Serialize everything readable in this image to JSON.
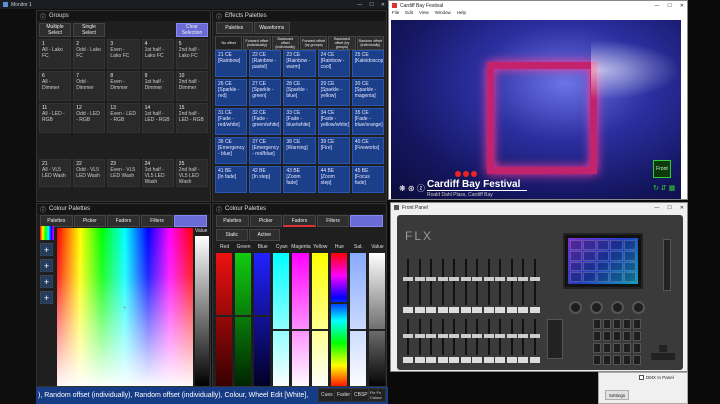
{
  "monitor": {
    "title": "Monitor 1"
  },
  "groups": {
    "title": "Groups",
    "buttons": [
      "Multiple Select",
      "Single Select",
      "Clear Selection"
    ],
    "tiles": [
      {
        "num": "1",
        "label": "All - Lako FC"
      },
      {
        "num": "2",
        "label": "Odd - Lako FC"
      },
      {
        "num": "3",
        "label": "Even - Lako FC"
      },
      {
        "num": "4",
        "label": "1st half - Lako FC"
      },
      {
        "num": "5",
        "label": "2nd half - Lako FC"
      },
      {
        "num": "6",
        "label": "All - Dimmer"
      },
      {
        "num": "7",
        "label": "Odd - Dimmer"
      },
      {
        "num": "8",
        "label": "Even - Dimmer"
      },
      {
        "num": "9",
        "label": "1st half - Dimmer"
      },
      {
        "num": "10",
        "label": "2nd half - Dimmer"
      },
      {
        "num": "11",
        "label": "All - LED - RGB"
      },
      {
        "num": "12",
        "label": "Odd - LED - RGB"
      },
      {
        "num": "13",
        "label": "Even - LED - RGB"
      },
      {
        "num": "14",
        "label": "1st half - LED - RGB"
      },
      {
        "num": "15",
        "label": "2nd half - LED - RGB"
      },
      {
        "num": "21",
        "label": "All - VL5 LED Wash"
      },
      {
        "num": "22",
        "label": "Odd - VL5 LED Wash"
      },
      {
        "num": "23",
        "label": "Even - VL5 LED Wash"
      },
      {
        "num": "24",
        "label": "1st half - VL5 LED Wash"
      },
      {
        "num": "25",
        "label": "2nd half - VL5 LED Wash"
      }
    ]
  },
  "effects": {
    "title": "Effects Palettes",
    "tabs": [
      "Palettes",
      "Waveforms"
    ],
    "headers": [
      "No offset",
      "Forward offset (individually)",
      "Backward offset (individually)",
      "Forward offset (by groups)",
      "Backward offset (by groups)",
      "Random offset (individually)"
    ],
    "tiles": [
      {
        "num": "21 CE",
        "label": "[Rainbow]"
      },
      {
        "num": "22 CE",
        "label": "[Rainbow - pastel]"
      },
      {
        "num": "23 CE",
        "label": "[Rainbow - warm]"
      },
      {
        "num": "24 CE",
        "label": "[Rainbow - cool]"
      },
      {
        "num": "25 CE",
        "label": "[Kaleidoscope]"
      },
      {
        "num": "26 CE",
        "label": "[Sparkle - red]"
      },
      {
        "num": "27 CE",
        "label": "[Sparkle - green]"
      },
      {
        "num": "28 CE",
        "label": "[Sparkle - blue]"
      },
      {
        "num": "29 CE",
        "label": "[Sparkle - yellow]"
      },
      {
        "num": "30 CE",
        "label": "[Sparkle - magenta]"
      },
      {
        "num": "31 CE",
        "label": "[Fade - red/white]"
      },
      {
        "num": "32 CE",
        "label": "[Fade - green/white]"
      },
      {
        "num": "33 CE",
        "label": "[Fade - blue/white]"
      },
      {
        "num": "34 CE",
        "label": "[Fade - yellow/white]"
      },
      {
        "num": "35 CE",
        "label": "[Fade - blue/orange]"
      },
      {
        "num": "36 CE",
        "label": "[Emergency - blue]"
      },
      {
        "num": "37 CE",
        "label": "[Emergency - red/blue]"
      },
      {
        "num": "38 CE",
        "label": "[Warning]"
      },
      {
        "num": "39 CE",
        "label": "[Fire]"
      },
      {
        "num": "40 CE",
        "label": "[Fireworks]"
      },
      {
        "num": "41 BE",
        "label": "[In fade]"
      },
      {
        "num": "42 BE",
        "label": "[In step]"
      },
      {
        "num": "43 BE",
        "label": "[Zoom fade]"
      },
      {
        "num": "44 BE",
        "label": "[Zoom step]"
      },
      {
        "num": "45 BE",
        "label": "[Focus fade]"
      }
    ]
  },
  "colour_left": {
    "title": "Colour Palettes",
    "tabs": [
      "Palettes",
      "Picker",
      "Faders",
      "Filters"
    ],
    "value_label": "Value",
    "plus": [
      "+",
      "+",
      "+",
      "+"
    ]
  },
  "colour_right": {
    "title": "Colour Palettes",
    "tabs": [
      "Palettes",
      "Picker",
      "Faders",
      "Filters"
    ],
    "subtabs": [
      "Static",
      "Active"
    ],
    "fader_labels": [
      "Red",
      "Green",
      "Blue",
      "Cyan",
      "Magenta",
      "Yellow",
      "Hue",
      "Sat.",
      "Value"
    ]
  },
  "status": {
    "text": "), Random offset (individually), Random offset (individually), Colour, Wheel Edit [White],"
  },
  "bottom_tabs": [
    "Cues",
    "Fader",
    "CBSP",
    "Fix Fx Colour"
  ],
  "festival": {
    "window_title": "Cardiff Bay Festival",
    "menu": [
      "File",
      "Edit",
      "View",
      "Window",
      "Help"
    ],
    "title": "Cardiff Bay Festival",
    "subtitle": "Roald Dahl Plass, Cardiff Bay",
    "front_label": "Front"
  },
  "front_panel": {
    "window_title": "Front Panel",
    "brand": "FLX"
  },
  "settings": {
    "checkbox_label": "DMX In Panel",
    "button": "Settings"
  }
}
